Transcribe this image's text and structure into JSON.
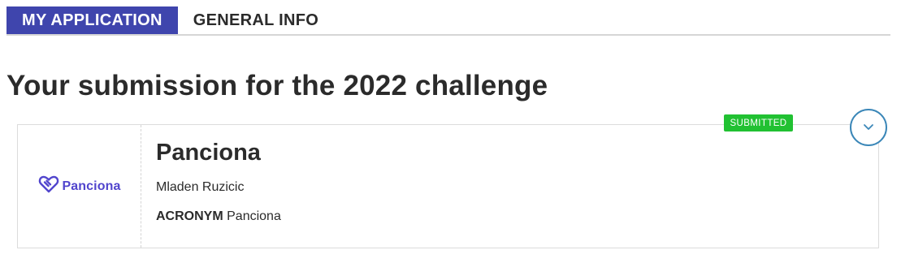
{
  "tabs": [
    {
      "label": "MY APPLICATION",
      "active": true
    },
    {
      "label": "GENERAL INFO",
      "active": false
    }
  ],
  "heading": "Your submission for the 2022 challenge",
  "submission": {
    "logo_text": "Panciona",
    "name": "Panciona",
    "owner": "Mladen Ruzicic",
    "acronym_label": "ACRONYM",
    "acronym_value": "Panciona",
    "status": "SUBMITTED"
  },
  "icons": {
    "logo": "handshake-heart-icon",
    "expand": "chevron-down-icon"
  },
  "colors": {
    "tab_active_bg": "#3f45ad",
    "brand_purple": "#5145cd",
    "status_green": "#21c132",
    "expand_blue": "#3b87b8"
  }
}
